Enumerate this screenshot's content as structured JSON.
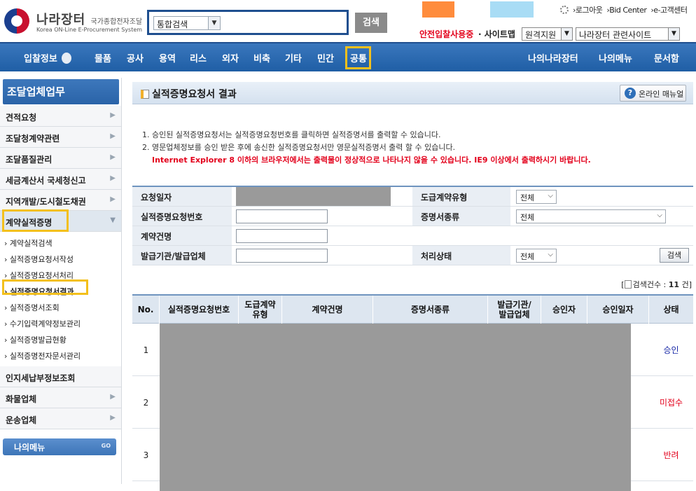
{
  "header": {
    "logo_title": "나라장터",
    "logo_title_suffix": "국가종합전자조달",
    "logo_subtitle": "Korea ON-Line E-Procurement System",
    "search_scope": "통합검색",
    "search_button": "검색",
    "top_links": [
      "›로그아웃",
      "›Bid Center",
      "›e-고객센터"
    ],
    "safe_link": "안전입찰사용중",
    "sitemap_link": "· 사이트맵",
    "remote_support": "원격지원",
    "related_sites": "나라장터 관련사이트",
    "colors": {
      "orange_swatch": "#ff8c3c",
      "blue_swatch": "#a8dcf5",
      "nav_blue": "#2a63a8",
      "highlight": "#f3c01c"
    }
  },
  "nav": {
    "items": [
      "입찰정보",
      "물품",
      "공사",
      "용역",
      "리스",
      "외자",
      "비축",
      "기타",
      "민간",
      "공통"
    ],
    "right_items": [
      "나의나라장터",
      "나의메뉴",
      "문서함"
    ]
  },
  "sidebar": {
    "title": "조달업체업무",
    "items": [
      {
        "label": "견적요청",
        "icon": "chevron-right-icon"
      },
      {
        "label": "조달청계약관련",
        "icon": "chevron-right-icon"
      },
      {
        "label": "조달품질관리",
        "icon": "chevron-right-icon"
      },
      {
        "label": "세금계산서 국세청신고",
        "icon": "chevron-right-icon"
      },
      {
        "label": "지역개발/도시철도채권",
        "icon": "chevron-right-icon"
      },
      {
        "label": "계약실적증명",
        "icon": "chevron-down-icon"
      }
    ],
    "subitems": [
      "› 계약실적검색",
      "› 실적증명요청서작성",
      "› 실적증명요청서처리",
      "› 실적증명요청서결과",
      "› 실적증명서조회",
      "› 수기입력계약정보관리",
      "› 실적증명발급현황",
      "› 실적증명전자문서관리"
    ],
    "items_after": [
      {
        "label": "인지세납부정보조회",
        "icon": ""
      },
      {
        "label": "화물업체",
        "icon": "chevron-right-icon"
      },
      {
        "label": "운송업체",
        "icon": "chevron-right-icon"
      }
    ],
    "my_menu": "나의메뉴",
    "my_menu_go": "GO"
  },
  "page": {
    "title": "실적증명요청서 결과",
    "manual_button": "온라인 매뉴얼",
    "notes": [
      "1. 승인된 실적증명요청서는 실적증명요청번호를 클릭하면 실적증명서를 출력할 수 있습니다.",
      "2. 영문업체정보를 승인 받은 후에 송신한 실적증명요청서만 영문실적증명서 출력 할 수 있습니다."
    ],
    "warning": "Internet Explorer 8 이하의 브라우저에서는 출력물이 정상적으로 나타나지 않을 수 있습니다. IE9 이상에서 출력하시기 바랍니다."
  },
  "form": {
    "request_date_label": "요청일자",
    "contract_type_label": "도급계약유형",
    "contract_type_value": "전체",
    "request_no_label": "실적증명요청번호",
    "request_no_value": "",
    "cert_type_label": "증명서종류",
    "cert_type_value": "전체",
    "contract_name_label": "계약건명",
    "contract_name_value": "",
    "issuer_label": "발급기관/발급업체",
    "issuer_value": "",
    "status_label": "처리상태",
    "status_value": "전체",
    "search_button": "검색"
  },
  "results": {
    "count_label": "검색건수 :",
    "count_value": "11",
    "count_unit": "건]",
    "count_open": "[",
    "columns": [
      "No.",
      "실적증명요청번호",
      "도급계약\n유형",
      "계약건명",
      "증명서종류",
      "발급기관/\n발급업체",
      "승인자",
      "승인일자",
      "상태"
    ],
    "rows": [
      {
        "no": "1",
        "status": "승인",
        "status_color": "#1a2aa8"
      },
      {
        "no": "2",
        "status": "미접수",
        "status_color": "#e3001b"
      },
      {
        "no": "3",
        "status": "반려",
        "status_color": "#e3001b"
      }
    ]
  }
}
